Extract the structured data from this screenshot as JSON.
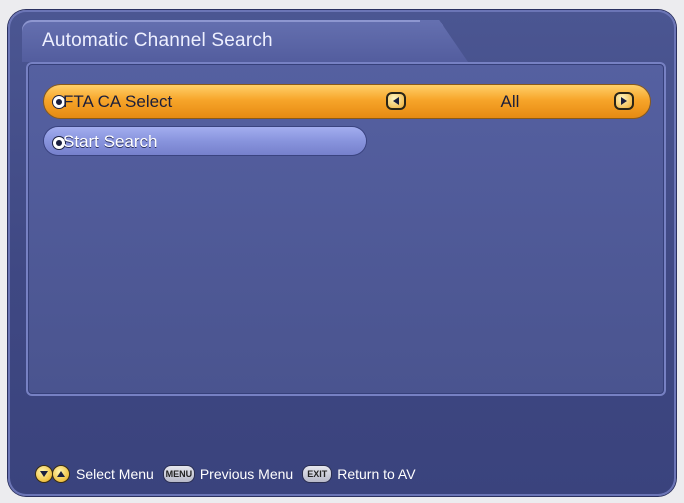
{
  "window": {
    "title": "Automatic Channel Search"
  },
  "menu": {
    "items": [
      {
        "label": "FTA CA Select",
        "value": "All",
        "selected": true,
        "icon": "bullet-icon"
      },
      {
        "label": "Start Search",
        "value": "",
        "selected": false,
        "icon": "bullet-icon"
      }
    ]
  },
  "footer": {
    "hints": [
      {
        "key": "▼▲",
        "label": "Select Menu"
      },
      {
        "key": "MENU",
        "label": "Previous Menu"
      },
      {
        "key": "EXIT",
        "label": "Return to AV"
      }
    ]
  },
  "colors": {
    "frame": "#3f4883",
    "panel": "#4a548f",
    "selected_row": "#f7a52a",
    "normal_row": "#8894dd",
    "text_light": "#ffffff",
    "text_dark": "#1b1e3b"
  }
}
